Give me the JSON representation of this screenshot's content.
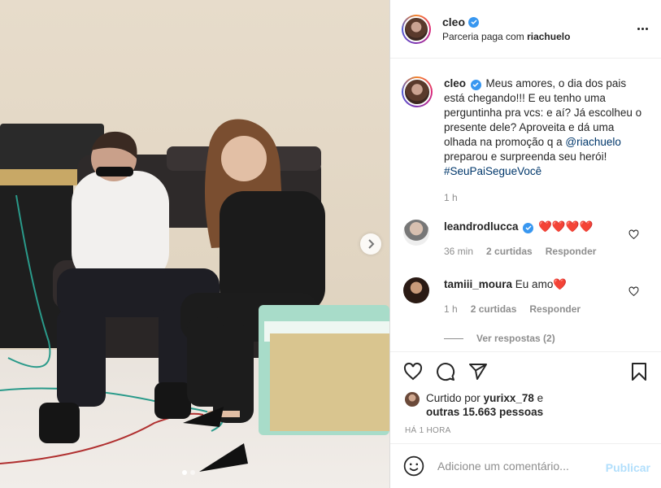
{
  "post": {
    "nav_next_icon": "chevron-right-icon",
    "carousel": {
      "slides": 2,
      "active": 1
    }
  },
  "header": {
    "username": "cleo",
    "partner_prefix": "Parceria paga com",
    "partner_name": "riachuelo",
    "more_icon": "more-options-icon"
  },
  "caption": {
    "username": "cleo",
    "text_part1": "Meus amores, o dia dos pais está chegando!!! E eu tenho uma perguntinha pra vcs: e aí? Já escolheu o presente dele? Aproveita e dá uma olhada na promoção q a",
    "mention": "@riachuelo",
    "text_part2": "preparou e surpreenda seu herói!",
    "hashtag": "#SeuPaiSegueVocê",
    "time": "1 h"
  },
  "comments": [
    {
      "username": "leandrodlucca",
      "text": "❤️❤️❤️❤️",
      "time": "36 min",
      "likes": "2 curtidas",
      "reply": "Responder"
    },
    {
      "username": "tamiii_moura",
      "text": "Eu amo❤️",
      "time": "1 h",
      "likes": "2 curtidas",
      "reply": "Responder"
    }
  ],
  "replies_label": "Ver respostas (2)",
  "likes": {
    "prefix": "Curtido por",
    "user": "yurixx_78",
    "conj": "e",
    "others": "outras 15.663 pessoas"
  },
  "time_ago": "HÁ 1 HORA",
  "add_comment": {
    "placeholder": "Adicione um comentário...",
    "publish": "Publicar"
  },
  "colors": {
    "link": "#00376b",
    "verified": "#3897f0",
    "heart": "#ed4956",
    "publish_disabled": "#b2dffc"
  }
}
